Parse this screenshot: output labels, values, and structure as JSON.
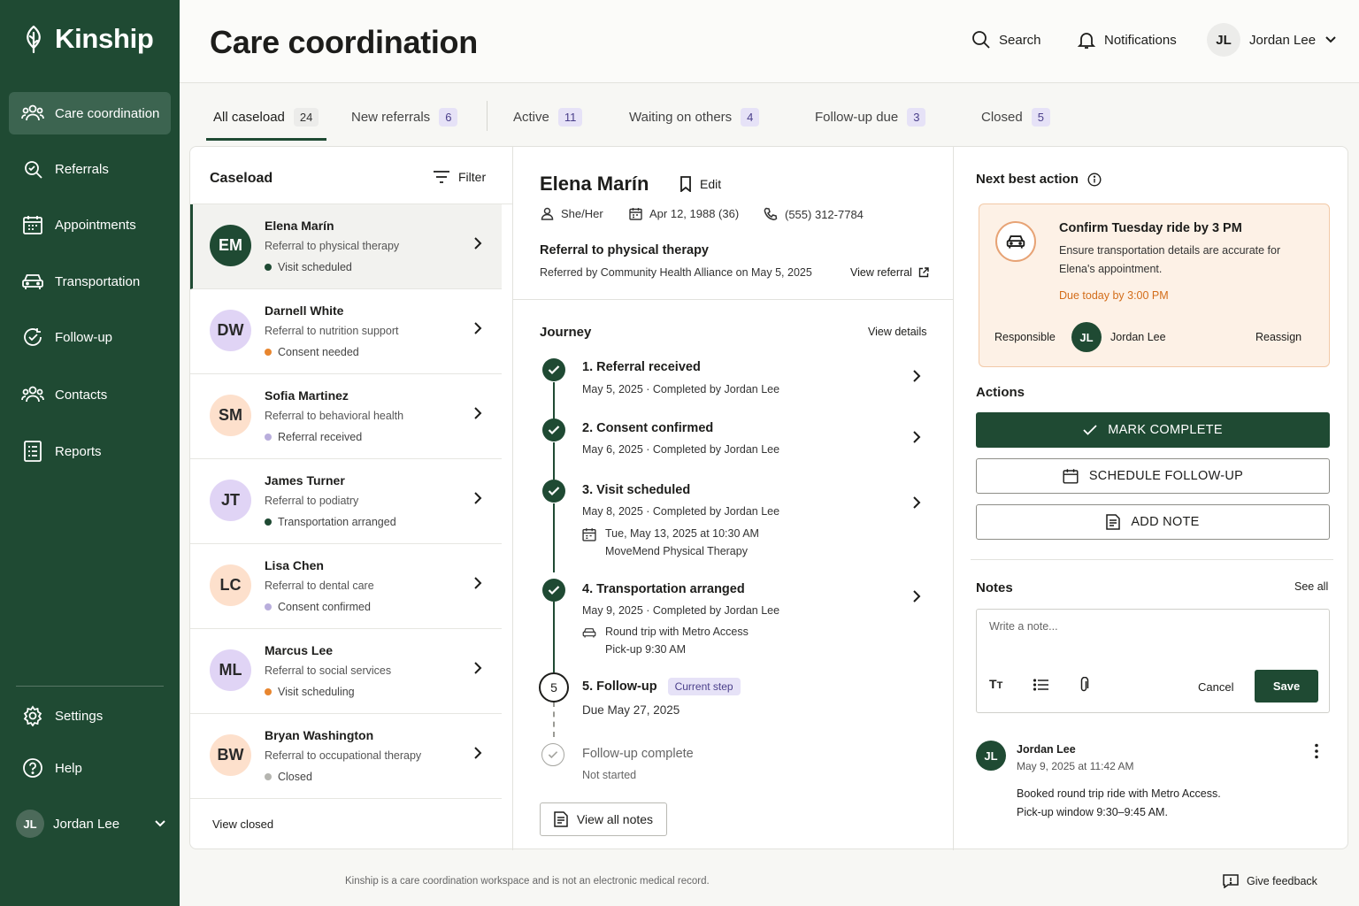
{
  "brand": {
    "name": "Kinship"
  },
  "sidebar": {
    "items": [
      {
        "label": "Care coordination"
      },
      {
        "label": "Referrals"
      },
      {
        "label": "Appointments"
      },
      {
        "label": "Transportation"
      },
      {
        "label": "Follow-up"
      },
      {
        "label": "Contacts"
      },
      {
        "label": "Reports"
      }
    ],
    "bottom": [
      {
        "label": "Settings"
      },
      {
        "label": "Help"
      }
    ],
    "user": {
      "initials": "JL",
      "name": "Jordan Lee"
    }
  },
  "header": {
    "title": "Care coordination",
    "search_label": "Search",
    "notifications_label": "Notifications",
    "user_initials": "JL",
    "user_name": "Jordan Lee"
  },
  "tabs": [
    {
      "label": "All caseload",
      "count": "24"
    },
    {
      "label": "New referrals",
      "count": "6"
    },
    {
      "label": "Active",
      "count": "11"
    },
    {
      "label": "Waiting on others",
      "count": "4"
    },
    {
      "label": "Follow-up due",
      "count": "3"
    },
    {
      "label": "Closed",
      "count": "5"
    }
  ],
  "caseload": {
    "title": "Caseload",
    "filter_label": "Filter",
    "view_closed": "View closed",
    "items": [
      {
        "initials": "EM",
        "name": "Elena Marín",
        "referral": "Referral to physical therapy",
        "status": "Visit scheduled"
      },
      {
        "initials": "DW",
        "name": "Darnell White",
        "referral": "Referral to nutrition support",
        "status": "Consent needed"
      },
      {
        "initials": "SM",
        "name": "Sofia Martinez",
        "referral": "Referral to behavioral health",
        "status": "Referral received"
      },
      {
        "initials": "JT",
        "name": "James Turner",
        "referral": "Referral to podiatry",
        "status": "Transportation arranged"
      },
      {
        "initials": "LC",
        "name": "Lisa Chen",
        "referral": "Referral to dental care",
        "status": "Consent confirmed"
      },
      {
        "initials": "ML",
        "name": "Marcus Lee",
        "referral": "Referral to social services",
        "status": "Visit scheduling"
      },
      {
        "initials": "BW",
        "name": "Bryan Washington",
        "referral": "Referral to occupational therapy",
        "status": "Closed"
      }
    ]
  },
  "detail": {
    "name": "Elena Marín",
    "edit_label": "Edit",
    "pronouns": "She/Her",
    "dob": "Apr 12, 1988 (36)",
    "phone": "(555) 312-7784",
    "referral_title": "Referral to physical therapy",
    "referral_by": "Referred by Community Health Alliance on May 5, 2025",
    "view_referral": "View referral",
    "journey_title": "Journey",
    "view_details": "View details",
    "steps": [
      {
        "title": "1. Referral received",
        "sub": "May 5, 2025  ·  Completed by Jordan Lee"
      },
      {
        "title": "2. Consent confirmed",
        "sub": "May 6, 2025  ·  Completed by Jordan Lee"
      },
      {
        "title": "3. Visit scheduled",
        "sub": "May 8, 2025  ·  Completed by Jordan Lee",
        "extra1": "Tue, May 13, 2025 at 10:30 AM",
        "extra2": "MoveMend Physical Therapy"
      },
      {
        "title": "4. Transportation arranged",
        "sub": "May 9, 2025  ·  Completed by Jordan Lee",
        "extra1": "Round trip with Metro Access",
        "extra2": "Pick-up 9:30 AM"
      },
      {
        "number": "5",
        "title": "5. Follow-up",
        "badge": "Current step",
        "sub": "Due May 27, 2025"
      },
      {
        "title": "Follow-up complete",
        "sub": "Not started"
      }
    ],
    "view_all_notes": "View all notes"
  },
  "next_best_action": {
    "title": "Next best action",
    "heading": "Confirm Tuesday ride by 3 PM",
    "description": "Ensure transportation details are accurate for Elena's appointment.",
    "due": "Due today by 3:00 PM",
    "responsible_label": "Responsible",
    "responsible_initials": "JL",
    "responsible_name": "Jordan Lee",
    "reassign": "Reassign"
  },
  "actions": {
    "title": "Actions",
    "mark_complete": "MARK COMPLETE",
    "schedule_follow_up": "SCHEDULE FOLLOW-UP",
    "add_note": "ADD NOTE"
  },
  "notes": {
    "title": "Notes",
    "see_all": "See all",
    "placeholder": "Write a note...",
    "cancel": "Cancel",
    "save": "Save",
    "entry": {
      "initials": "JL",
      "author": "Jordan Lee",
      "date": "May 9, 2025 at 11:42 AM",
      "line1": "Booked round trip ride with Metro Access.",
      "line2": "Pick-up window 9:30–9:45 AM."
    }
  },
  "footer": {
    "disclaimer": "Kinship is a care coordination workspace and is not an electronic medical record.",
    "feedback": "Give feedback"
  },
  "colors": {
    "brand_green": "#1f4a33",
    "accent_purple": "#e6e2f7",
    "orange": "#e8862f"
  }
}
